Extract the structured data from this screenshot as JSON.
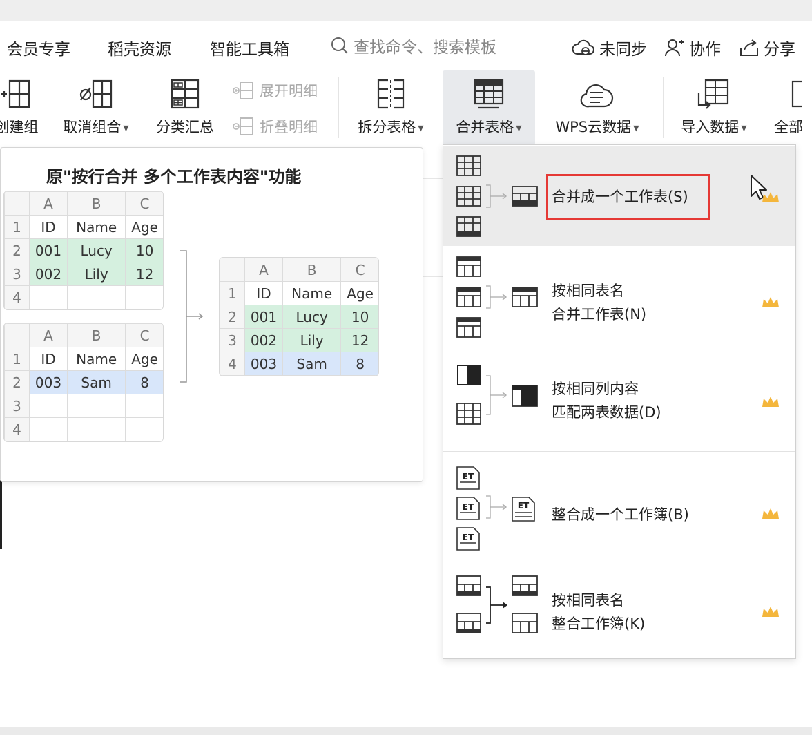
{
  "menubar": {
    "items": [
      "会员专享",
      "稻壳资源",
      "智能工具箱"
    ],
    "search_placeholder": "查找命令、搜索模板",
    "right": {
      "sync": "未同步",
      "collab": "协作",
      "share": "分享"
    }
  },
  "toolbar": {
    "create_group": "创建组",
    "ungroup": "取消组合",
    "subtotal": "分类汇总",
    "expand_detail": "展开明细",
    "collapse_detail": "折叠明细",
    "split_table": "拆分表格",
    "merge_table": "合并表格",
    "wps_cloud": "WPS云数据",
    "import_data": "导入数据",
    "all": "全部"
  },
  "tooltip": {
    "title": "原\"按行合并 多个工作表内容\"功能",
    "col_headers": [
      "A",
      "B",
      "C"
    ],
    "table1": {
      "rows": [
        [
          "ID",
          "Name",
          "Age"
        ],
        [
          "001",
          "Lucy",
          "10"
        ],
        [
          "002",
          "Lily",
          "12"
        ],
        [
          "",
          "",
          ""
        ]
      ],
      "row_nums": [
        "1",
        "2",
        "3",
        "4"
      ]
    },
    "table2": {
      "rows": [
        [
          "ID",
          "Name",
          "Age"
        ],
        [
          "003",
          "Sam",
          "8"
        ],
        [
          "",
          "",
          ""
        ],
        [
          "",
          "",
          ""
        ]
      ],
      "row_nums": [
        "1",
        "2",
        "3",
        "4"
      ]
    },
    "result": {
      "rows": [
        [
          "ID",
          "Name",
          "Age"
        ],
        [
          "001",
          "Lucy",
          "10"
        ],
        [
          "002",
          "Lily",
          "12"
        ],
        [
          "003",
          "Sam",
          "8"
        ]
      ],
      "row_nums": [
        "1",
        "2",
        "3",
        "4"
      ]
    }
  },
  "dropdown": {
    "items": [
      {
        "line1": "合并成一个工作表(S)",
        "line2": ""
      },
      {
        "line1": "按相同表名",
        "line2": "合并工作表(N)"
      },
      {
        "line1": "按相同列内容",
        "line2": "匹配两表数据(D)"
      },
      {
        "line1": "整合成一个工作簿(B)",
        "line2": ""
      },
      {
        "line1": "按相同表名",
        "line2": "整合工作簿(K)"
      }
    ],
    "et_label": "ET"
  },
  "colors": {
    "crown": "#f4b63c",
    "highlight_box": "#e53935",
    "green_cell": "#d5f0df",
    "blue_cell": "#d8e6fa"
  }
}
